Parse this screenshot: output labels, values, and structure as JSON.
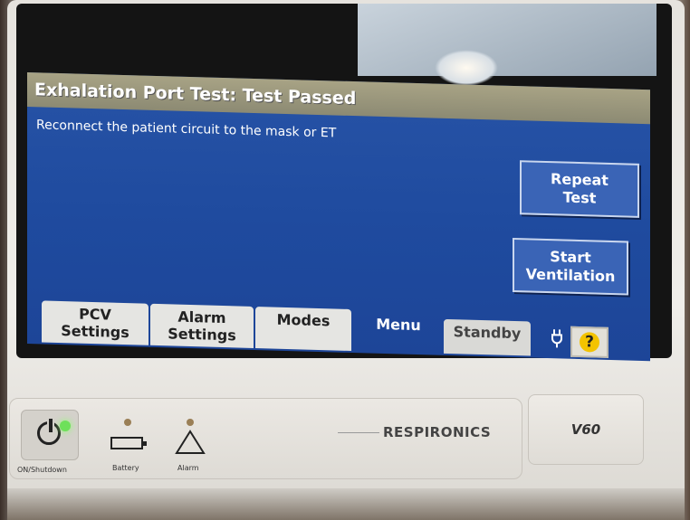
{
  "screen": {
    "title": "Exhalation Port Test: Test Passed",
    "message": "Reconnect the patient circuit to the mask or ET",
    "buttons": {
      "repeat_test": [
        "Repeat",
        "Test"
      ],
      "start_ventilation": [
        "Start",
        "Ventilation"
      ]
    },
    "tabs": {
      "pcv_settings": [
        "PCV",
        "Settings"
      ],
      "alarm_settings": [
        "Alarm",
        "Settings"
      ],
      "modes": "Modes",
      "menu": "Menu",
      "standby": "Standby"
    },
    "help_label": "?"
  },
  "device": {
    "power_label": "ON/Shutdown",
    "battery_label": "Battery",
    "alarm_label": "Alarm",
    "brand": "RESPIRONICS",
    "model": "V60"
  },
  "colors": {
    "screen_blue": "#1f4b9f",
    "title_bar": "#9b977c",
    "tab_gray": "#e5e5e2",
    "power_led": "#6ee05a",
    "help_yellow": "#f3c300"
  },
  "icons": [
    "plug-icon",
    "help-icon",
    "power-icon",
    "battery-icon",
    "alarm-icon"
  ]
}
